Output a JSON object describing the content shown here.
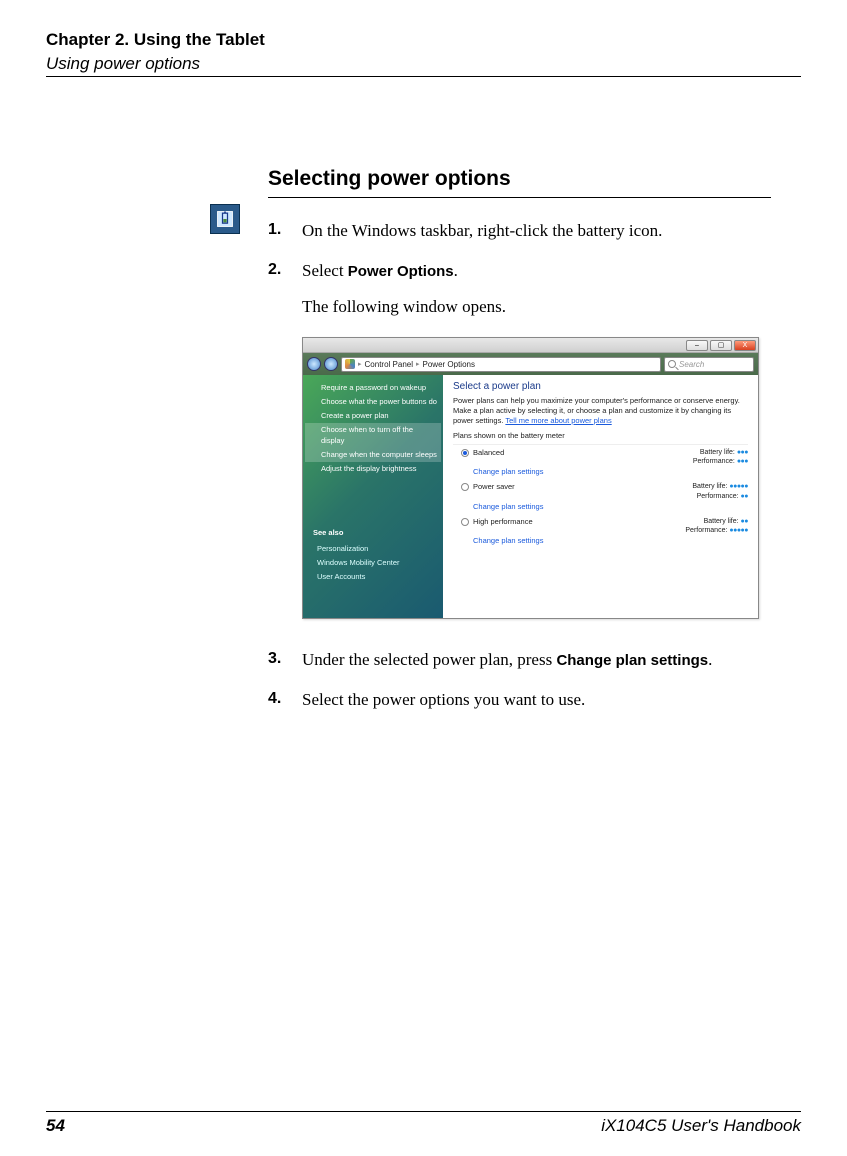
{
  "header": {
    "chapter": "Chapter 2. Using the Tablet",
    "subsection": "Using power options"
  },
  "heading": "Selecting power options",
  "steps": [
    {
      "num": "1.",
      "text": "On the Windows taskbar, right-click the battery icon."
    },
    {
      "num": "2.",
      "pre": "Select ",
      "bold": "Power Options",
      "post": "."
    },
    {
      "num": "3.",
      "pre": "Under the selected power plan, press ",
      "bold": "Change plan settings",
      "post": "."
    },
    {
      "num": "4.",
      "text": "Select the power options you want to use."
    }
  ],
  "followup": "The following window opens.",
  "window": {
    "buttons": {
      "min": "–",
      "max": "▢",
      "close": "X"
    },
    "breadcrumb": {
      "part1": "Control Panel",
      "part2": "Power Options"
    },
    "search_placeholder": "Search",
    "sidebar": {
      "tasks": [
        "Require a password on wakeup",
        "Choose what the power buttons do",
        "Create a power plan",
        "Choose when to turn off the display",
        "Change when the computer sleeps",
        "Adjust the display brightness"
      ],
      "highlight_indexes": [
        3,
        4
      ],
      "see_also_heading": "See also",
      "see_also": [
        "Personalization",
        "Windows Mobility Center",
        "User Accounts"
      ]
    },
    "main": {
      "title": "Select a power plan",
      "desc_pre": "Power plans can help you maximize your computer's performance or conserve energy. Make a plan active by selecting it, or choose a plan and customize it by changing its power settings. ",
      "desc_link": "Tell me more about power plans",
      "subtitle": "Plans shown on the battery meter",
      "change_link": "Change plan settings",
      "battery_label": "Battery life:",
      "perf_label": "Performance:",
      "plans": [
        {
          "name": "Balanced",
          "selected": true,
          "battery": "●●●",
          "perf": "●●●"
        },
        {
          "name": "Power saver",
          "selected": false,
          "battery": "●●●●●",
          "perf": "●●"
        },
        {
          "name": "High performance",
          "selected": false,
          "battery": "●●",
          "perf": "●●●●●"
        }
      ]
    }
  },
  "footer": {
    "page": "54",
    "book": "iX104C5 User's Handbook"
  }
}
